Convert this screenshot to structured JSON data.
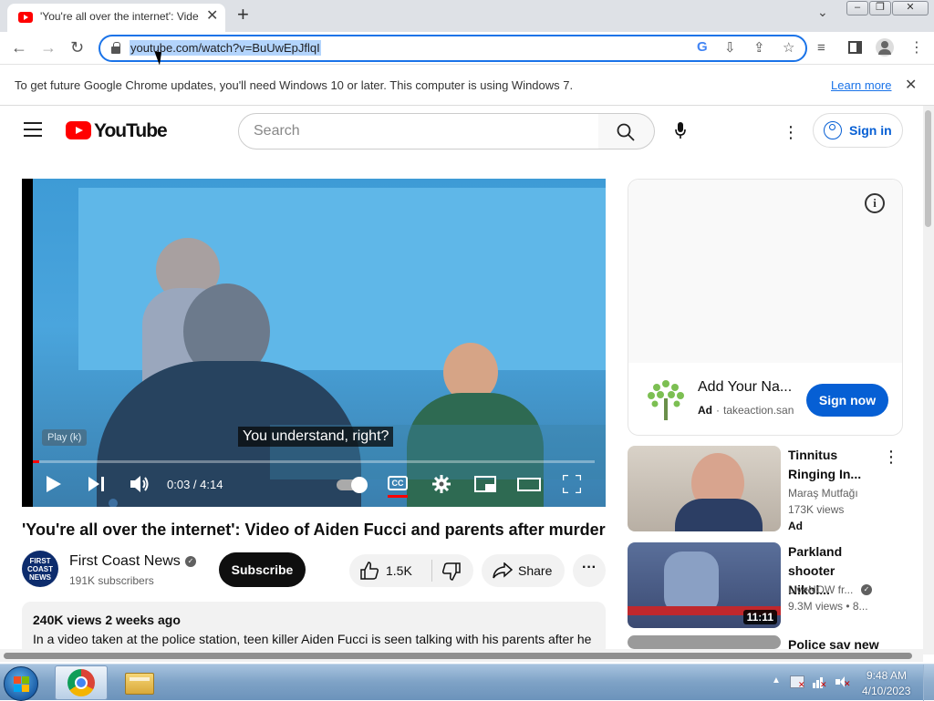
{
  "browser": {
    "tab_title": "'You're all over the internet': Vide",
    "url": "youtube.com/watch?v=BuUwEpJflqI",
    "infobar_message": "To get future Google Chrome updates, you'll need Windows 10 or later. This computer is using Windows 7.",
    "infobar_link": "Learn more"
  },
  "youtube": {
    "logo_text": "YouTube",
    "search_placeholder": "Search",
    "sign_in_label": "Sign in"
  },
  "player": {
    "caption": "You understand, right?",
    "overlay_hint": "Play (k)",
    "time_display": "0:03 / 4:14",
    "progress_fraction": 0.012,
    "cc_label": "CC"
  },
  "video": {
    "title": "'You're all over the internet': Video of Aiden Fucci and parents after murder",
    "channel_avatar_text": "FIRST COAST NEWS",
    "channel_name": "First Coast News",
    "subscribers": "191K subscribers",
    "subscribe_label": "Subscribe",
    "likes": "1.5K",
    "share_label": "Share",
    "description_meta": "240K views  2 weeks ago",
    "description_text": "In a video taken at the police station, teen killer Aiden Fucci is seen talking with his parents after he"
  },
  "ad": {
    "title": "Add Your Na...",
    "label": "Ad",
    "domain": "takeaction.san",
    "cta": "Sign now"
  },
  "recommendations": [
    {
      "title": "Tinnitus Ringing In...",
      "channel": "Maraş Mutfağı",
      "views": "173K views",
      "badge": "Ad",
      "duration": ""
    },
    {
      "title": "Parkland shooter Nikol...",
      "channel": "LiveNOW fr...",
      "views": "9.3M views  •  8...",
      "badge": "",
      "duration": "11:11"
    },
    {
      "title": "Police sav new",
      "channel": "",
      "views": "",
      "badge": "",
      "duration": ""
    }
  ],
  "taskbar": {
    "time": "9:48 AM",
    "date": "4/10/2023"
  },
  "colors": {
    "youtube_red": "#ff0000",
    "link_blue": "#065fd4",
    "chrome_focus": "#1a73e8"
  }
}
